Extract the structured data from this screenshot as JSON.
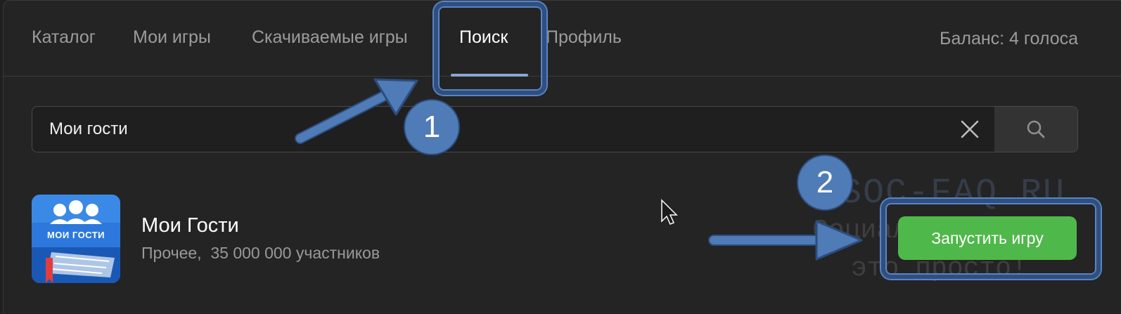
{
  "tabs": [
    {
      "label": "Каталог"
    },
    {
      "label": "Мои игры"
    },
    {
      "label": "Скачиваемые игры"
    },
    {
      "label": "Поиск"
    },
    {
      "label": "Профиль"
    }
  ],
  "balance": "Баланс: 4 голоса",
  "search": {
    "value": "Мои гости"
  },
  "result": {
    "title": "Мои Гости",
    "meta": "Прочее,  35 000 000 участников",
    "icon_text": "МОИ ГОСТИ",
    "launch_label": "Запустить игру"
  },
  "annotations": {
    "badge_1": "1",
    "badge_2": "2"
  },
  "watermark": {
    "line1": "SOC-FAQ.RU",
    "line2": "Социальные сети",
    "line3": "это просто!"
  },
  "colors": {
    "accent_green": "#4fb84a",
    "annotation_blue": "#4f7bb6",
    "tab_underline": "#8aa6d4"
  }
}
